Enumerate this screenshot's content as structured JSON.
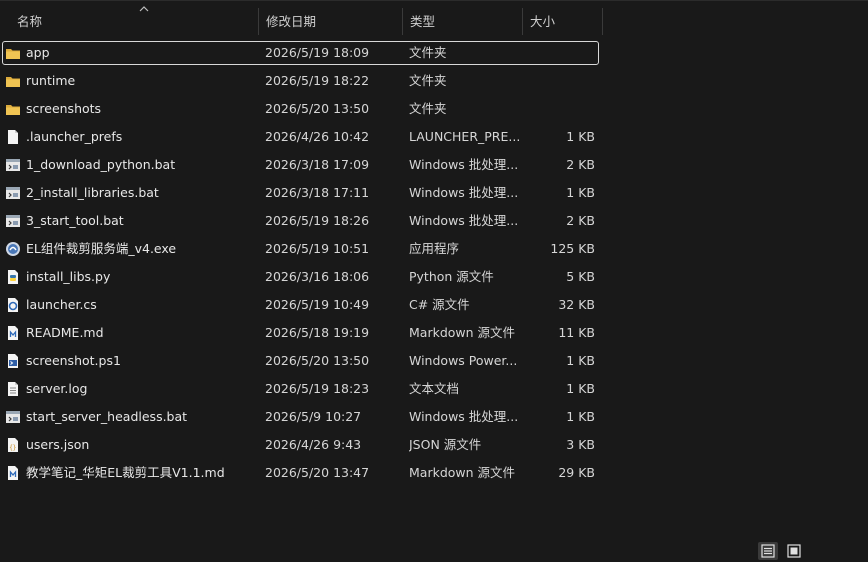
{
  "columns": {
    "name": "名称",
    "date": "修改日期",
    "type": "类型",
    "size": "大小"
  },
  "files": [
    {
      "name": "app",
      "date": "2026/5/19 18:09",
      "type": "文件夹",
      "size": "",
      "icon": "folder-icon",
      "selected": true
    },
    {
      "name": "runtime",
      "date": "2026/5/19 18:22",
      "type": "文件夹",
      "size": "",
      "icon": "folder-icon"
    },
    {
      "name": "screenshots",
      "date": "2026/5/20 13:50",
      "type": "文件夹",
      "size": "",
      "icon": "folder-icon"
    },
    {
      "name": ".launcher_prefs",
      "date": "2026/4/26 10:42",
      "type": "LAUNCHER_PRE...",
      "size": "1 KB",
      "icon": "file-icon"
    },
    {
      "name": "1_download_python.bat",
      "date": "2026/3/18 17:09",
      "type": "Windows 批处理...",
      "size": "2 KB",
      "icon": "batch-file-icon"
    },
    {
      "name": "2_install_libraries.bat",
      "date": "2026/3/18 17:11",
      "type": "Windows 批处理...",
      "size": "1 KB",
      "icon": "batch-file-icon"
    },
    {
      "name": "3_start_tool.bat",
      "date": "2026/5/19 18:26",
      "type": "Windows 批处理...",
      "size": "2 KB",
      "icon": "batch-file-icon"
    },
    {
      "name": "EL组件裁剪服务端_v4.exe",
      "date": "2026/5/19 10:51",
      "type": "应用程序",
      "size": "125 KB",
      "icon": "exe-icon"
    },
    {
      "name": "install_libs.py",
      "date": "2026/3/16 18:06",
      "type": "Python 源文件",
      "size": "5 KB",
      "icon": "python-file-icon"
    },
    {
      "name": "launcher.cs",
      "date": "2026/5/19 10:49",
      "type": "C# 源文件",
      "size": "32 KB",
      "icon": "csharp-file-icon"
    },
    {
      "name": "README.md",
      "date": "2026/5/18 19:19",
      "type": "Markdown 源文件",
      "size": "11 KB",
      "icon": "markdown-file-icon"
    },
    {
      "name": "screenshot.ps1",
      "date": "2026/5/20 13:50",
      "type": "Windows Power...",
      "size": "1 KB",
      "icon": "powershell-file-icon"
    },
    {
      "name": "server.log",
      "date": "2026/5/19 18:23",
      "type": "文本文档",
      "size": "1 KB",
      "icon": "text-file-icon"
    },
    {
      "name": "start_server_headless.bat",
      "date": "2026/5/9 10:27",
      "type": "Windows 批处理...",
      "size": "1 KB",
      "icon": "batch-file-icon"
    },
    {
      "name": "users.json",
      "date": "2026/4/26 9:43",
      "type": "JSON 源文件",
      "size": "3 KB",
      "icon": "json-file-icon"
    },
    {
      "name": "教学笔记_华矩EL裁剪工具V1.1.md",
      "date": "2026/5/20 13:47",
      "type": "Markdown 源文件",
      "size": "29 KB",
      "icon": "markdown-file-icon"
    }
  ],
  "view": {
    "details_icon": "details-view-icon",
    "tiles_icon": "large-icons-view-icon"
  },
  "colors": {
    "background": "#191919",
    "folder": "#e8b84a",
    "selection_border": "#d8d8d8"
  }
}
